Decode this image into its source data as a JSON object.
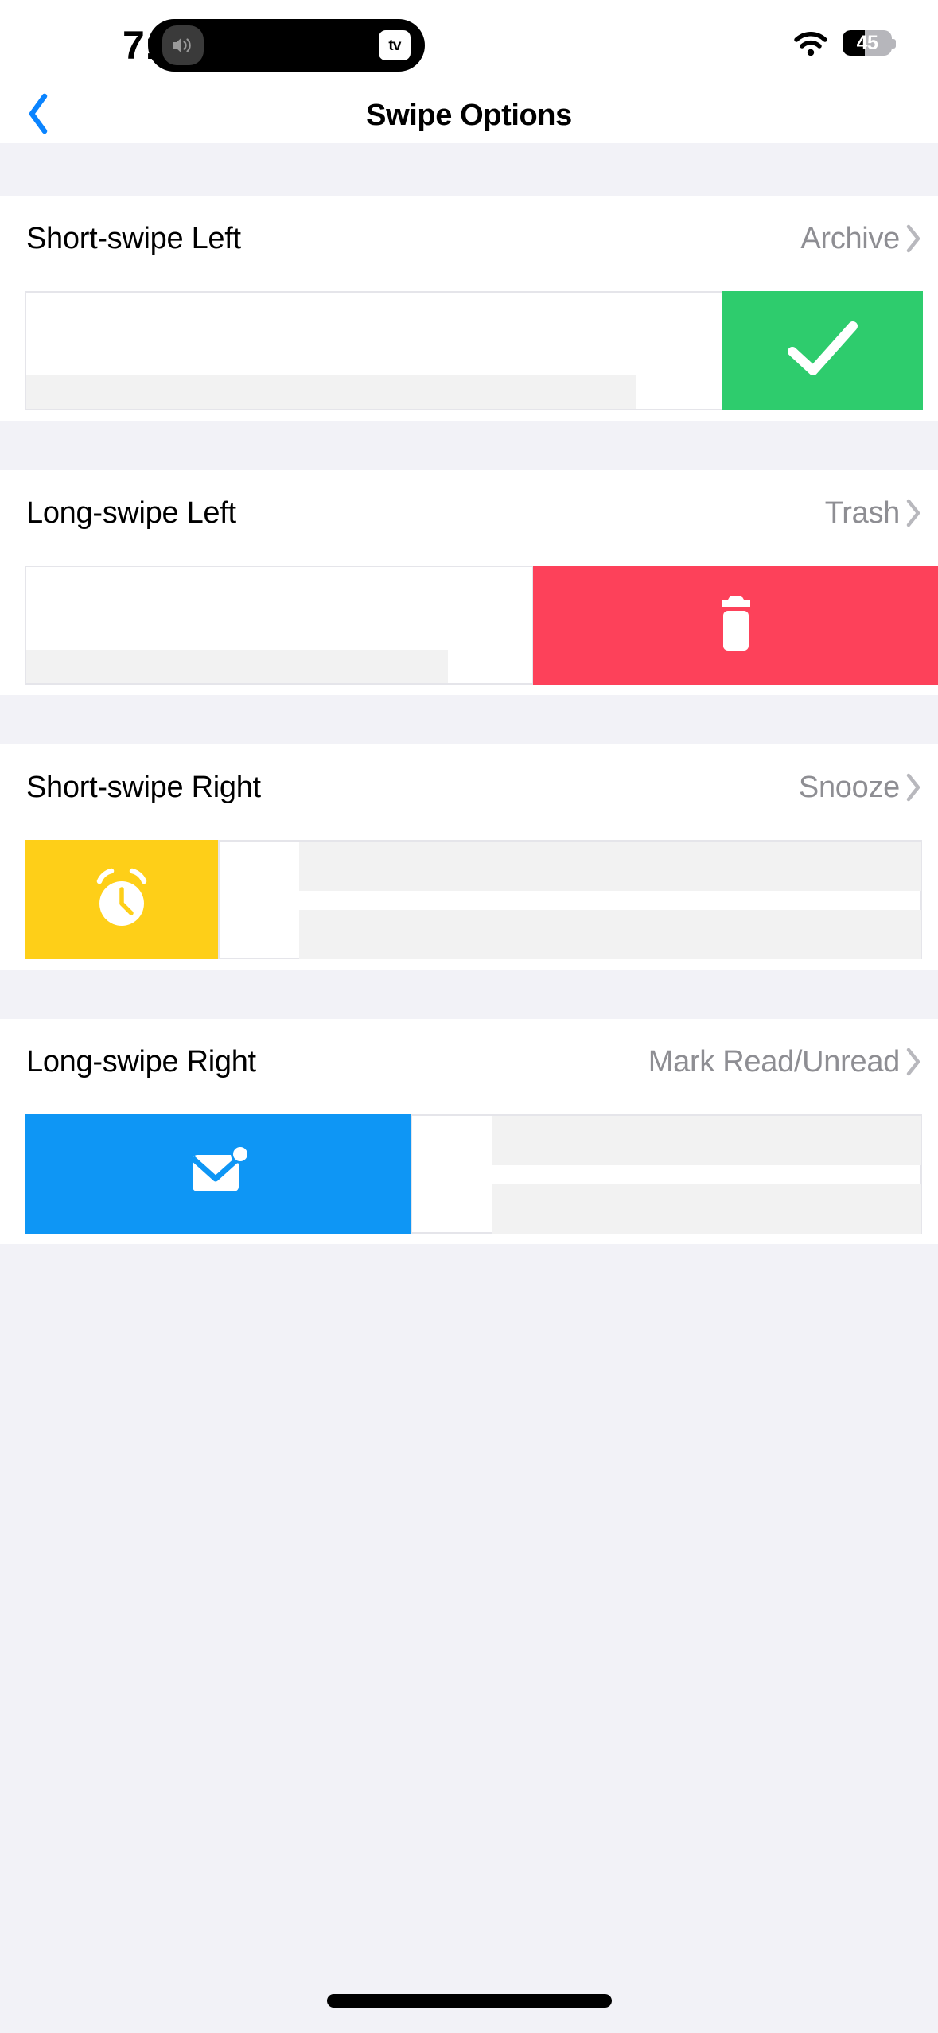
{
  "status_bar": {
    "time": "7:44",
    "dynamic_island": {
      "speaker_icon": "speaker-wave-icon",
      "activity_badge": "apple-tv-icon",
      "activity_label": "tv"
    },
    "wifi_icon": "wifi-icon",
    "battery": {
      "level": "45",
      "percent": 45
    }
  },
  "nav": {
    "back_icon": "chevron-left-icon",
    "title": "Swipe Options"
  },
  "sections": [
    {
      "title": "Short-swipe Left",
      "value": "Archive",
      "chevron_icon": "chevron-right-icon",
      "preview": {
        "action_icon": "checkmark-icon",
        "action_color": "#2ecc6d",
        "action_side": "right",
        "action_width_pct": 36
      }
    },
    {
      "title": "Long-swipe Left",
      "value": "Trash",
      "chevron_icon": "chevron-right-icon",
      "preview": {
        "action_icon": "trash-icon",
        "action_color": "#fd415a",
        "action_side": "right",
        "action_width_pct": 65
      }
    },
    {
      "title": "Short-swipe Right",
      "value": "Snooze",
      "chevron_icon": "chevron-right-icon",
      "preview": {
        "action_icon": "alarm-clock-icon",
        "action_color": "#fecf18",
        "action_side": "left",
        "action_width_pct": 21
      }
    },
    {
      "title": "Long-swipe Right",
      "value": "Mark Read/Unread",
      "chevron_icon": "chevron-right-icon",
      "preview": {
        "action_icon": "envelope-badge-icon",
        "action_color": "#0e96f5",
        "action_side": "left",
        "action_width_pct": 42
      }
    }
  ],
  "colors": {
    "group_background": "#f2f2f7",
    "cell_background": "#ffffff",
    "separator": "#e5e5ea",
    "secondary_label": "#8e8e93",
    "tint": "#0a84ff",
    "archive_green": "#2ecc6d",
    "trash_red": "#fd415a",
    "snooze_yellow": "#fecf18",
    "mail_blue": "#0e96f5"
  },
  "home_indicator": "home-indicator"
}
